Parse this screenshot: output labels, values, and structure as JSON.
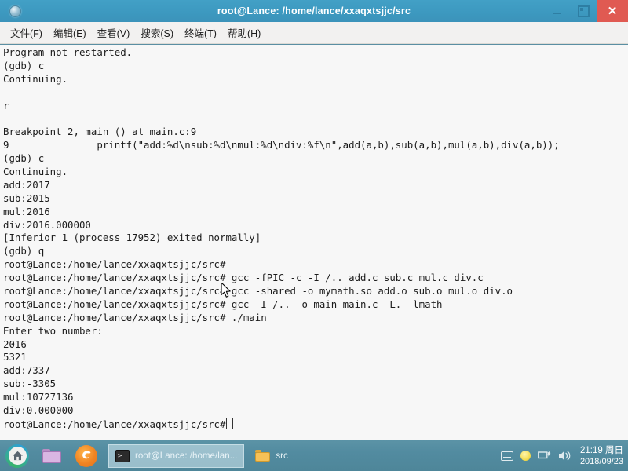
{
  "window": {
    "title": "root@Lance: /home/lance/xxaqxtsjjc/src",
    "icon": "terminal-circle-icon",
    "buttons": {
      "minimize": "–",
      "maximize": "❐",
      "close": "✕"
    }
  },
  "menubar": {
    "items": [
      {
        "label": "文件(F)",
        "name": "menu-file"
      },
      {
        "label": "编辑(E)",
        "name": "menu-edit"
      },
      {
        "label": "查看(V)",
        "name": "menu-view"
      },
      {
        "label": "搜索(S)",
        "name": "menu-search"
      },
      {
        "label": "终端(T)",
        "name": "menu-terminal"
      },
      {
        "label": "帮助(H)",
        "name": "menu-help"
      }
    ]
  },
  "terminal": {
    "prompt": "root@Lance:/home/lance/xxaqxtsjjc/src#",
    "background_color": "#f7f7f7",
    "text_color": "#1c1c1c",
    "lines": [
      "Program not restarted.",
      "(gdb) c",
      "Continuing.",
      "",
      "r",
      "",
      "Breakpoint 2, main () at main.c:9",
      "9               printf(\"add:%d\\nsub:%d\\nmul:%d\\ndiv:%f\\n\",add(a,b),sub(a,b),mul(a,b),div(a,b));",
      "(gdb) c",
      "Continuing.",
      "add:2017",
      "sub:2015",
      "mul:2016",
      "div:2016.000000",
      "[Inferior 1 (process 17952) exited normally]",
      "(gdb) q",
      "root@Lance:/home/lance/xxaqxtsjjc/src#",
      "root@Lance:/home/lance/xxaqxtsjjc/src# gcc -fPIC -c -I /.. add.c sub.c mul.c div.c",
      "root@Lance:/home/lance/xxaqxtsjjc/src# gcc -shared -o mymath.so add.o sub.o mul.o div.o",
      "root@Lance:/home/lance/xxaqxtsjjc/src# gcc -I /.. -o main main.c -L. -lmath",
      "root@Lance:/home/lance/xxaqxtsjjc/src# ./main",
      "Enter two number:",
      "2016",
      "5321",
      "add:7337",
      "sub:-3305",
      "mul:10727136",
      "div:0.000000"
    ],
    "last_prompt": "root@Lance:/home/lance/xxaqxtsjjc/src#"
  },
  "taskbar": {
    "launchers": [
      {
        "name": "home-menu-button",
        "icon": "home-icon"
      },
      {
        "name": "file-manager-launcher",
        "icon": "folder-icon"
      },
      {
        "name": "firefox-launcher",
        "icon": "firefox-icon"
      }
    ],
    "windows": [
      {
        "label": "root@Lance: /home/lan...",
        "icon": "terminal-icon",
        "active": true
      },
      {
        "label": "src",
        "icon": "folder-icon",
        "active": false
      }
    ],
    "tray": [
      {
        "name": "keyboard-layout-icon"
      },
      {
        "name": "brightness-icon"
      },
      {
        "name": "network-icon"
      },
      {
        "name": "volume-icon"
      }
    ],
    "clock": {
      "time": "21:19 周日",
      "date": "2018/09/23"
    }
  }
}
